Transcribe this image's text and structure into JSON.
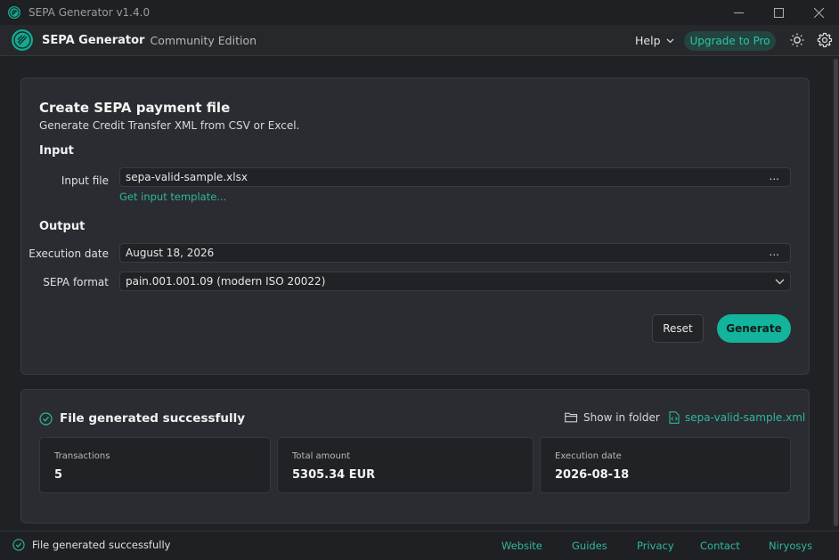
{
  "window": {
    "title": "SEPA Generator v1.4.0"
  },
  "header": {
    "brand": "SEPA Generator",
    "edition": "Community Edition",
    "help_label": "Help",
    "upgrade_label": "Upgrade to Pro"
  },
  "form": {
    "title": "Create SEPA payment file",
    "subtitle": "Generate Credit Transfer XML from CSV or Excel.",
    "input_section": "Input",
    "input_file_label": "Input file",
    "input_file_value": "sepa-valid-sample.xlsx",
    "browse_label": "...",
    "template_link": "Get input template...",
    "output_section": "Output",
    "execution_date_label": "Execution date",
    "execution_date_value": "August 18, 2026",
    "sepa_format_label": "SEPA format",
    "sepa_format_value": "pain.001.001.09 (modern ISO 20022)",
    "reset_label": "Reset",
    "generate_label": "Generate"
  },
  "result": {
    "title": "File generated successfully",
    "show_folder_label": "Show in folder",
    "file_link": "sepa-valid-sample.xml",
    "stats": [
      {
        "label": "Transactions",
        "value": "5"
      },
      {
        "label": "Total amount",
        "value": "5305.34 EUR"
      },
      {
        "label": "Execution date",
        "value": "2026-08-18"
      }
    ]
  },
  "statusbar": {
    "message": "File generated successfully",
    "links": [
      "Website",
      "Guides",
      "Privacy",
      "Contact",
      "Niryosys"
    ]
  },
  "colors": {
    "accent": "#14b39b",
    "link": "#2db89c",
    "background": "#202124",
    "card": "#2a2c31"
  }
}
